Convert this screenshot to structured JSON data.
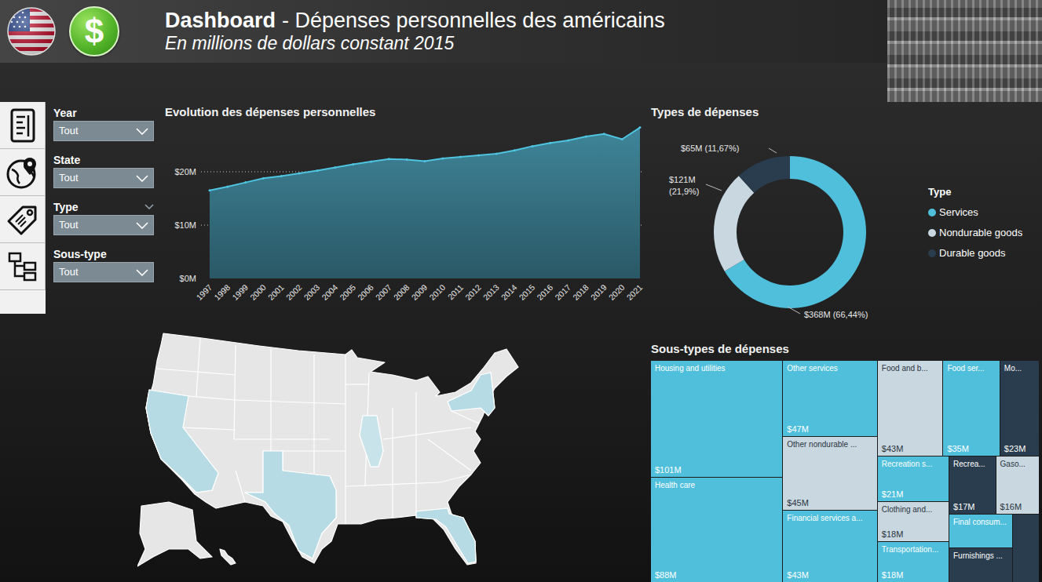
{
  "header": {
    "logo_symbol": "$",
    "title_bold": "Dashboard",
    "title_rest": "- Dépenses personnelles des américains",
    "subtitle": "En millions de dollars constant 2015"
  },
  "filters": [
    {
      "label": "Year",
      "value": "Tout",
      "hint": false
    },
    {
      "label": "State",
      "value": "Tout",
      "hint": false
    },
    {
      "label": "Type",
      "value": "Tout",
      "hint": true
    },
    {
      "label": "Sous-type",
      "value": "Tout",
      "hint": false
    }
  ],
  "line_chart": {
    "title": "Evolution des dépenses personnelles",
    "y_ticks": [
      {
        "label": "$0M",
        "value": 0
      },
      {
        "label": "$10M",
        "value": 10
      },
      {
        "label": "$20M",
        "value": 20
      }
    ],
    "years": [
      "1997",
      "1998",
      "1999",
      "2000",
      "2001",
      "2002",
      "2003",
      "2004",
      "2005",
      "2006",
      "2007",
      "2008",
      "2009",
      "2010",
      "2011",
      "2012",
      "2013",
      "2014",
      "2015",
      "2016",
      "2017",
      "2018",
      "2019",
      "2020",
      "2021"
    ],
    "values": [
      16.5,
      17.2,
      18.0,
      18.8,
      19.2,
      19.7,
      20.2,
      20.8,
      21.4,
      21.9,
      22.4,
      22.3,
      22.0,
      22.5,
      22.8,
      23.1,
      23.4,
      24.0,
      24.8,
      25.4,
      25.9,
      26.6,
      27.1,
      26.1,
      28.3
    ]
  },
  "donut": {
    "title": "Types de dépenses",
    "legend_title": "Type",
    "slices": [
      {
        "name": "Services",
        "value": 368,
        "label_lines": [
          "$368M (66,44%)"
        ],
        "color": "#4fbfdc"
      },
      {
        "name": "Nondurable goods",
        "value": 121,
        "label_lines": [
          "$121M",
          "(21,9%)"
        ],
        "color": "#c9d7e1"
      },
      {
        "name": "Durable goods",
        "value": 65,
        "label_lines": [
          "$65M (11,67%)"
        ],
        "color": "#2a3d4e"
      }
    ]
  },
  "map": {
    "regions": [
      {
        "color": "#e6e6e6"
      },
      {
        "color": "#e6e6e6"
      },
      {
        "color": "#e6e6e6"
      },
      {
        "color": "#b6dbe5"
      },
      {
        "color": "#b6dbe5"
      },
      {
        "color": "#b6dbe5"
      },
      {
        "color": "#b6dbe5"
      },
      {
        "color": "#c9e3ea"
      }
    ]
  },
  "treemap": {
    "title": "Sous-types de dépenses",
    "tiles": [
      {
        "label": "Housing and utilities",
        "value": "$101M",
        "color": "#4fbfdc"
      },
      {
        "label": "Health care",
        "value": "$88M",
        "color": "#4fbfdc"
      },
      {
        "label": "Other services",
        "value": "$47M",
        "color": "#4fbfdc"
      },
      {
        "label": "Other nondurable ...",
        "value": "$45M",
        "color": "#c9d7e1"
      },
      {
        "label": "Financial services a...",
        "value": "$43M",
        "color": "#4fbfdc"
      },
      {
        "label": "Food and b...",
        "value": "$43M",
        "color": "#c9d7e1"
      },
      {
        "label": "Food ser...",
        "value": "$35M",
        "color": "#4fbfdc"
      },
      {
        "label": "Mo...",
        "value": "$23M",
        "color": "#2a3d4e"
      },
      {
        "label": "Recreation s...",
        "value": "$21M",
        "color": "#4fbfdc"
      },
      {
        "label": "Clothing and...",
        "value": "$18M",
        "color": "#c9d7e1"
      },
      {
        "label": "Transportation...",
        "value": "$18M",
        "color": "#4fbfdc"
      },
      {
        "label": "Recrea...",
        "value": "$17M",
        "color": "#2a3d4e"
      },
      {
        "label": "Gaso...",
        "value": "$16M",
        "color": "#c9d7e1"
      },
      {
        "label": "Final consum...",
        "color": "#4fbfdc"
      },
      {
        "label": "Furnishings ...",
        "color": "#2a3d4e"
      },
      {
        "color": "#2a3d4e"
      }
    ]
  }
}
